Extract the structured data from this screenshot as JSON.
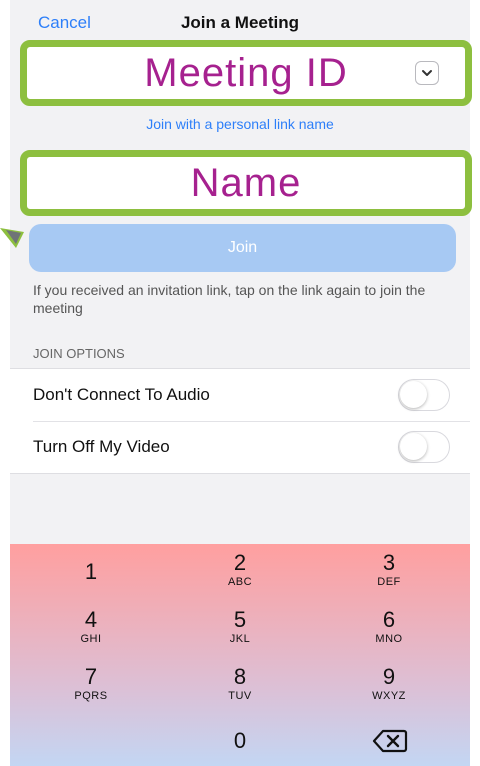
{
  "nav": {
    "cancel": "Cancel",
    "title": "Join a Meeting"
  },
  "meeting_id": {
    "placeholder": "Meeting ID"
  },
  "personal_link": "Join with a personal link name",
  "name": {
    "placeholder": "Name"
  },
  "join_button": "Join",
  "hint": "If you received an invitation link, tap on the link again to join the meeting",
  "options_header": "JOIN OPTIONS",
  "options": [
    {
      "label": "Don't Connect To Audio",
      "on": false
    },
    {
      "label": "Turn Off My Video",
      "on": false
    }
  ],
  "keypad": [
    {
      "num": "1",
      "letters": ""
    },
    {
      "num": "2",
      "letters": "ABC"
    },
    {
      "num": "3",
      "letters": "DEF"
    },
    {
      "num": "4",
      "letters": "GHI"
    },
    {
      "num": "5",
      "letters": "JKL"
    },
    {
      "num": "6",
      "letters": "MNO"
    },
    {
      "num": "7",
      "letters": "PQRS"
    },
    {
      "num": "8",
      "letters": "TUV"
    },
    {
      "num": "9",
      "letters": "WXYZ"
    },
    {
      "num": "0",
      "letters": ""
    }
  ],
  "colors": {
    "accent": "#2d7ff9",
    "highlight_border": "#8dbf3f",
    "highlight_text": "#a6218f",
    "join_button": "#a7c9f3"
  },
  "icons": {
    "dropdown": "chevron-down-icon",
    "backspace": "backspace-icon",
    "pointer": "pointer-arrow-icon"
  }
}
